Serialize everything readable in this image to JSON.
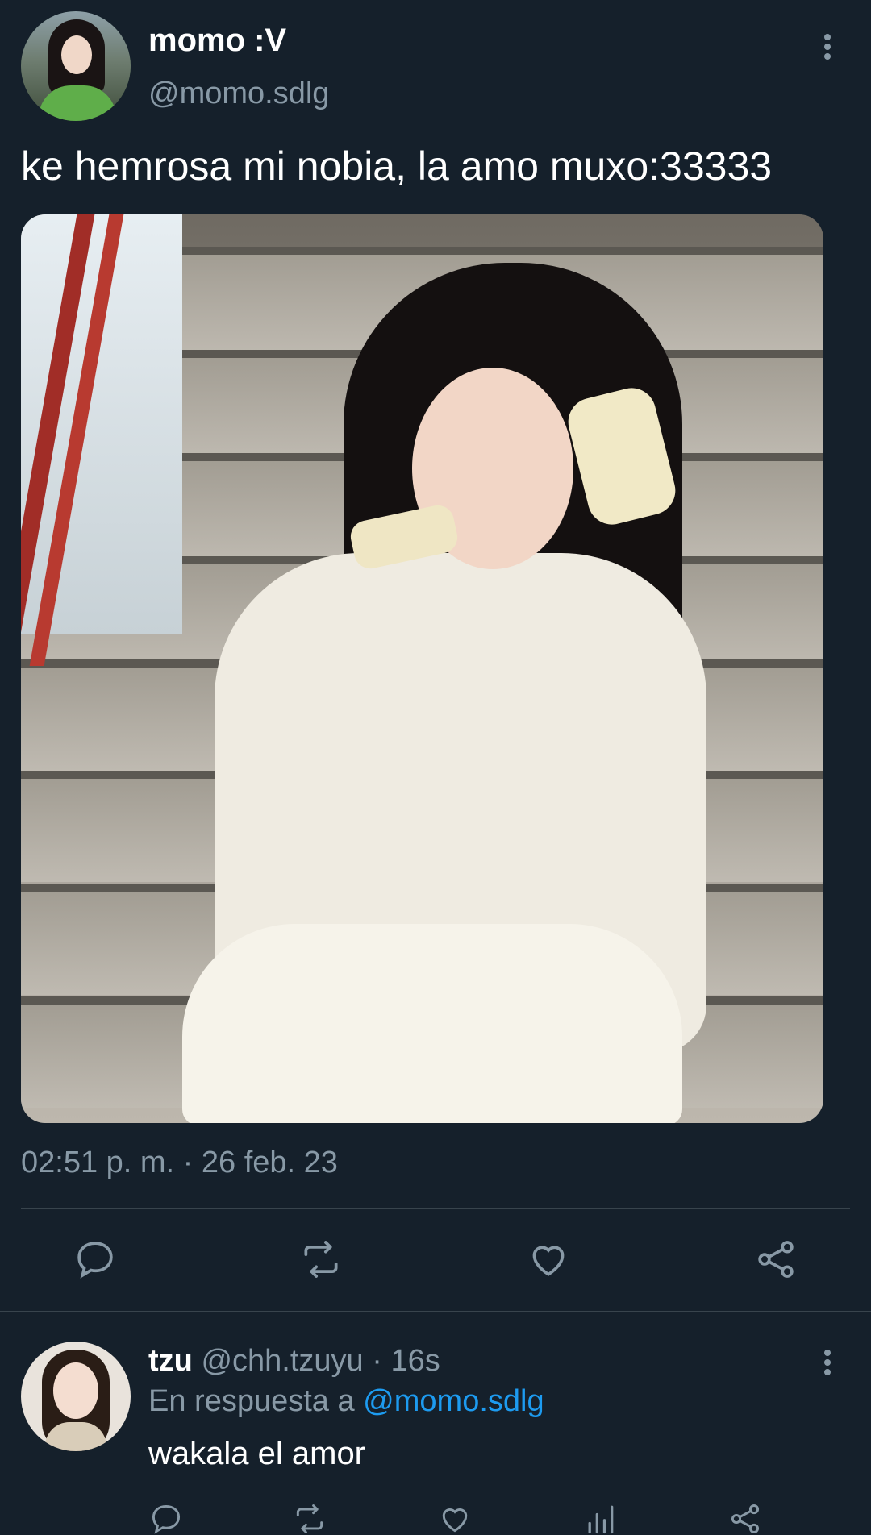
{
  "tweet": {
    "author_name": "momo :V",
    "author_handle": "@momo.sdlg",
    "text": "ke hemrosa mi nobia, la amo muxo:33333",
    "timestamp": "02:51 p. m. · 26 feb. 23",
    "actions": [
      "reply-icon",
      "retweet-icon",
      "like-icon",
      "share-icon"
    ]
  },
  "reply": {
    "author_name": "tzu",
    "author_handle": "@chh.tzuyu",
    "separator": " · ",
    "time_ago": "16s",
    "reply_prefix": "En respuesta a ",
    "reply_to": "@momo.sdlg",
    "text": "wakala el amor",
    "actions": [
      "reply-icon",
      "retweet-icon",
      "like-icon",
      "analytics-icon",
      "share-icon"
    ]
  },
  "colors": {
    "background": "#15202b",
    "secondary_text": "#8899a6",
    "link": "#1d9bf0",
    "divider": "#38444d"
  }
}
